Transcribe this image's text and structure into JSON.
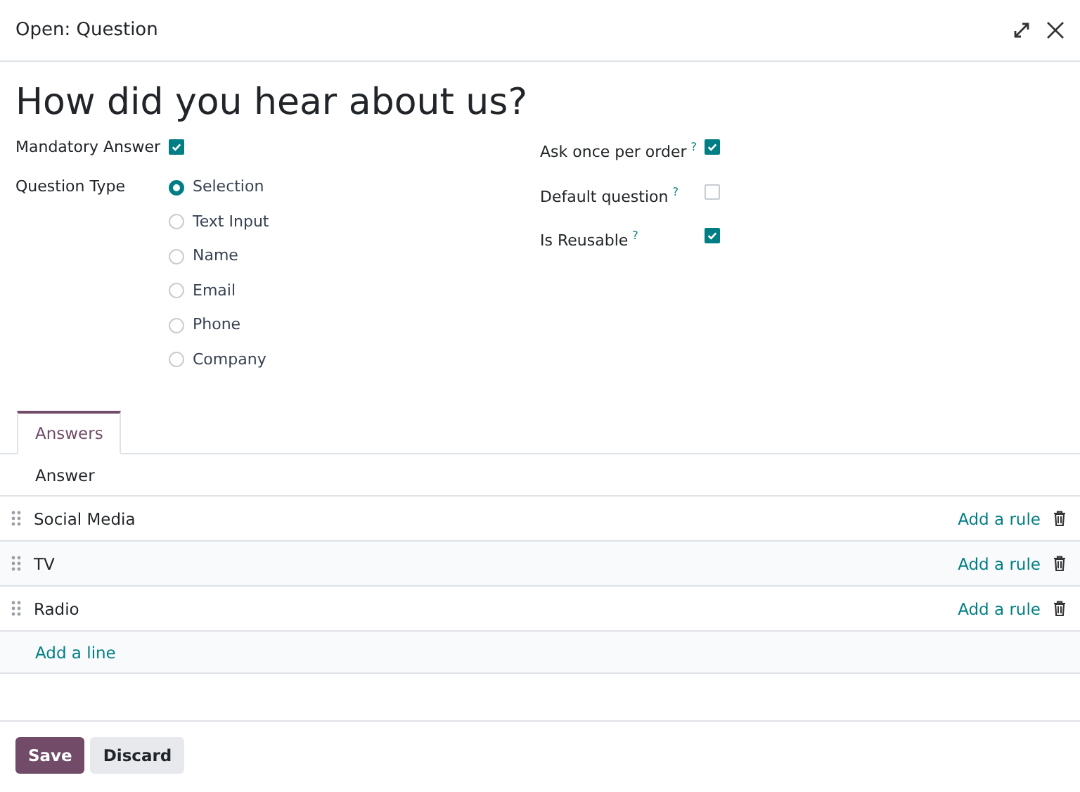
{
  "window": {
    "title": "Open: Question"
  },
  "question": "How did you hear about us?",
  "left_fields": [
    {
      "kind": "checkbox",
      "label": "Mandatory Answer",
      "checked": true
    },
    {
      "kind": "radio",
      "label": "Question Type",
      "options": [
        {
          "label": "Selection",
          "selected": true
        },
        {
          "label": "Text Input",
          "selected": false
        },
        {
          "label": "Name",
          "selected": false
        },
        {
          "label": "Email",
          "selected": false
        },
        {
          "label": "Phone",
          "selected": false
        },
        {
          "label": "Company",
          "selected": false
        }
      ]
    }
  ],
  "right_fields": [
    {
      "label": "Ask once per order",
      "help": "?",
      "checked": true
    },
    {
      "label": "Default question",
      "help": "?",
      "checked": false
    },
    {
      "label": "Is Reusable",
      "help": "?",
      "checked": true
    }
  ],
  "tabs": [
    {
      "label": "Answers",
      "selected": true
    }
  ],
  "table": {
    "columns": [
      "Answer"
    ],
    "rows": [
      {
        "answer": "Social Media",
        "action": "Add a rule"
      },
      {
        "answer": "TV",
        "action": "Add a rule"
      },
      {
        "answer": "Radio",
        "action": "Add a rule"
      }
    ],
    "add_line": "Add a line"
  },
  "buttons": [
    {
      "label": "Save",
      "kind": "primary"
    },
    {
      "label": "Discard",
      "kind": "secondary"
    }
  ]
}
